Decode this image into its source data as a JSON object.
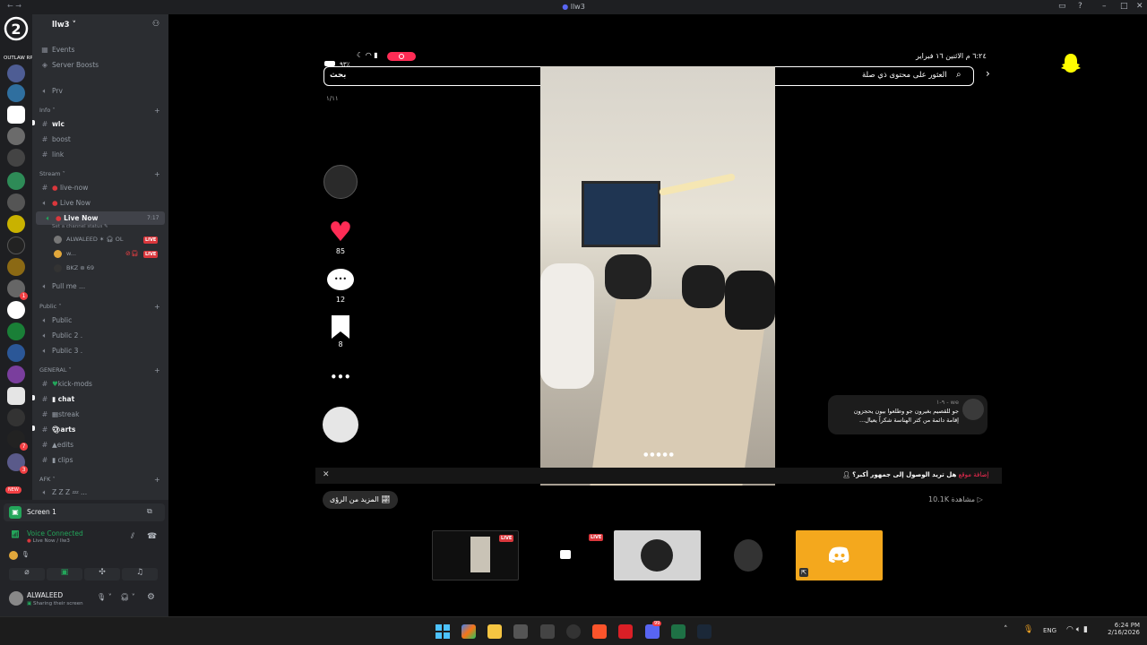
{
  "window": {
    "title": "llw3",
    "controls": [
      "inbox-icon",
      "help-icon",
      "minimize",
      "maximize",
      "close"
    ]
  },
  "server": {
    "name": "llw3",
    "logo_text": "OUTLAW RP",
    "top_items": [
      "Events",
      "Server Boosts"
    ]
  },
  "channels": {
    "prv": "Prv",
    "info_cat": "Info",
    "info": [
      "wlc",
      "boost",
      "link"
    ],
    "stream_cat": "Stream",
    "stream": [
      "live-now",
      "Live Now",
      "Live Now"
    ],
    "active_channel_time": "7:17",
    "channel_status": "Set a channel status",
    "voice_users": [
      {
        "name": "ALWALEED",
        "extra": "OL",
        "live": "LIVE"
      },
      {
        "name": "w...",
        "extra": "",
        "live": "LIVE"
      },
      {
        "name": "BKZ",
        "extra": "69",
        "live": ""
      }
    ],
    "pull": "Pull me ...",
    "public_cat": "Public",
    "public": [
      "Public",
      "Public 2 .",
      "Public 3 ."
    ],
    "general_cat": "GENERAL",
    "general": [
      "kick-mods",
      "chat",
      "streak",
      "arts",
      "edits",
      "clips"
    ],
    "afk_cat": "AFK",
    "afk": "Z Z Z"
  },
  "voice": {
    "screen": "Screen 1",
    "connected": "Voice Connected",
    "location": "Live Now / llw3",
    "user": "ALWALEED",
    "user_status": "Sharing their screen"
  },
  "rail_badges": [
    "1",
    "7",
    "3",
    "NEW"
  ],
  "phone": {
    "time": "٦:٢٤ م",
    "date": "الاثنين ١٦ فبراير",
    "battery": "٩٣٪",
    "search_button": "بحث",
    "search_placeholder": "العثور على محتوى ذي صلة",
    "counter": "١/١١",
    "likes": "85",
    "comments": "12",
    "saves": "8",
    "more": "•••",
    "comment_user": "we - ٩-١",
    "comment_text_1": "جو للقصيم بغيرون جو وطلعوا بيون يحجزون",
    "comment_text_2": "إقامة دائمة من كثر الهناسة شكراً يعيال...",
    "promo_text": "هل تريد الوصول إلى جمهور أكبر؟",
    "promo_link": "إضافة موقع",
    "more_insights": "المزيد من الرؤى",
    "views": "10.1K مشاهدة"
  },
  "thumbs": {
    "live_label": "LIVE"
  },
  "taskbar": {
    "lang": "ENG",
    "time": "6:24 PM",
    "date": "2/16/2026",
    "discord_badge": "99"
  },
  "colors": {
    "accent": "#5865f2",
    "live": "#da373c",
    "heart": "#fe2c55",
    "snap": "#fffc00",
    "discord_orange": "#f4a81d"
  }
}
